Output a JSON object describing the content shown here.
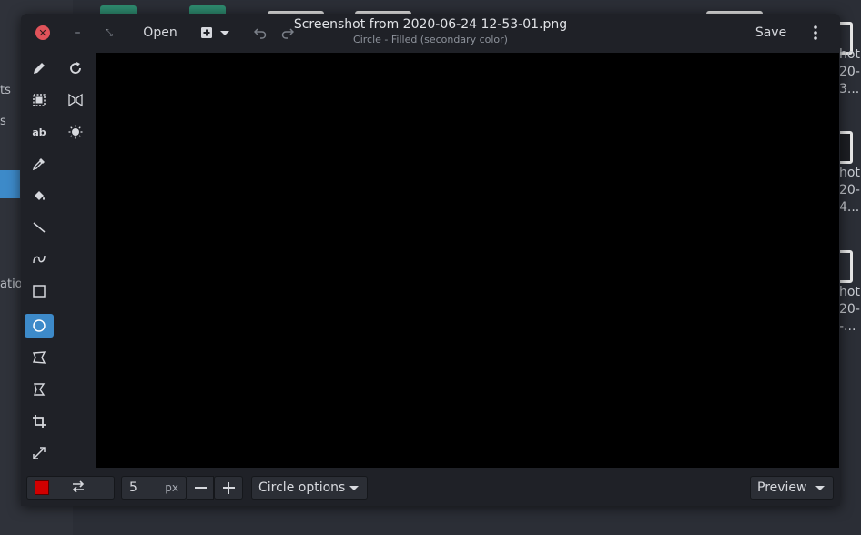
{
  "window": {
    "title": "Screenshot from 2020-06-24 12-53-01.png",
    "subtitle": "Circle - Filled (secondary color)"
  },
  "headerbar": {
    "open_label": "Open",
    "save_label": "Save"
  },
  "bottombar": {
    "size_value": "5",
    "size_unit": "px",
    "options_label": "Circle options",
    "preview_label": "Preview",
    "primary_color": "#d10000"
  },
  "background": {
    "sidebar_fragments": [
      "ts",
      "s",
      "atio"
    ],
    "file_fragments": [
      [
        "hot",
        "20-",
        "3..."
      ],
      [
        "hot",
        "20-",
        "4..."
      ],
      [
        "hot",
        "20-",
        "-..."
      ]
    ]
  },
  "tools": {
    "left": [
      "pencil-icon",
      "select-rect-icon",
      "text-icon",
      "color-picker-icon",
      "paint-bucket-icon",
      "line-icon",
      "curve-icon",
      "rectangle-icon",
      "circle-icon",
      "free-shape-icon",
      "polygon-icon",
      "crop-icon",
      "scale-icon"
    ],
    "right": [
      "rotate-icon",
      "flip-icon",
      "filters-icon"
    ],
    "active": "circle-icon"
  }
}
